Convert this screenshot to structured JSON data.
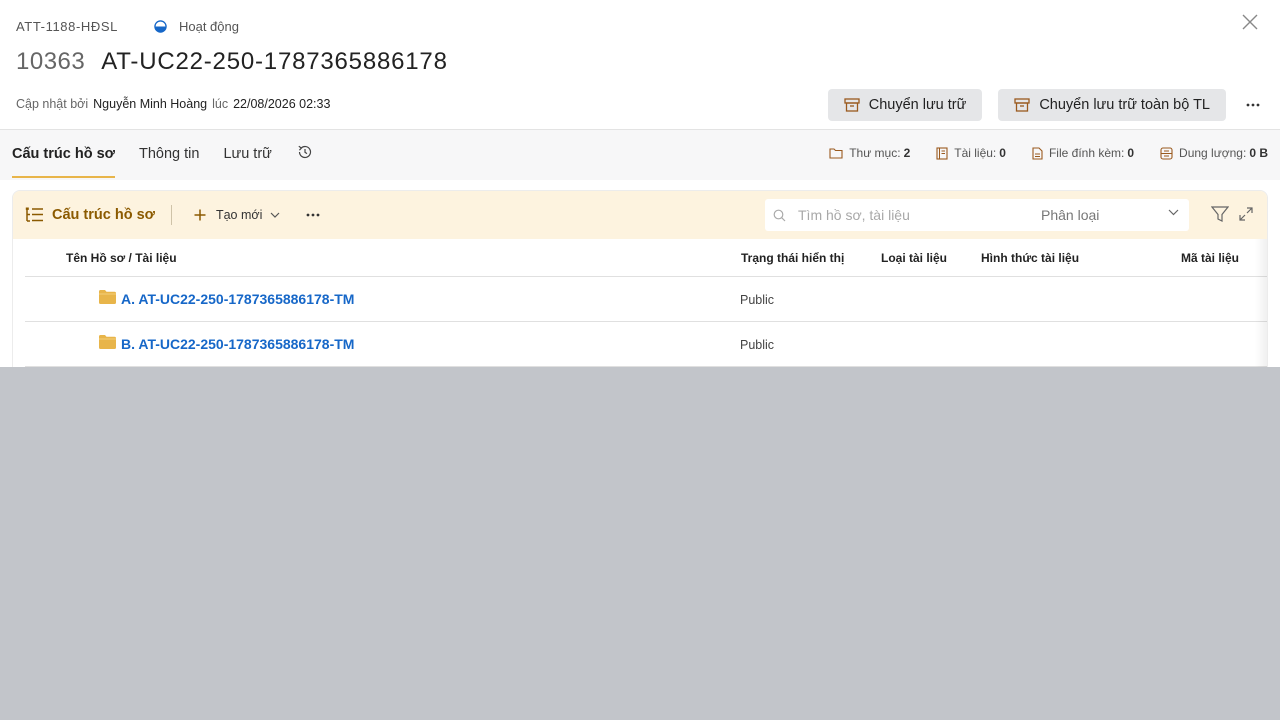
{
  "header": {
    "code": "ATT-1188-HĐSL",
    "status": "Hoạt động",
    "record_number": "10363",
    "record_title": "AT-UC22-250-1787365886178",
    "updated_by_label": "Cập nhật bởi",
    "updated_by": "Nguyễn Minh Hoàng",
    "at_label": "lúc",
    "updated_at": "22/08/2026 02:33"
  },
  "actions": {
    "archive": "Chuyển lưu trữ",
    "archive_all": "Chuyển lưu trữ toàn bộ TL"
  },
  "tabs": [
    {
      "label": "Cấu trúc hồ sơ",
      "active": true
    },
    {
      "label": "Thông tin",
      "active": false
    },
    {
      "label": "Lưu trữ",
      "active": false
    }
  ],
  "stats": {
    "folders_label": "Thư mục:",
    "folders": "2",
    "docs_label": "Tài liệu:",
    "docs": "0",
    "attachments_label": "File đính kèm:",
    "attachments": "0",
    "size_label": "Dung lượng:",
    "size": "0 B"
  },
  "toolbar": {
    "title": "Cấu trúc hồ sơ",
    "create_label": "Tạo mới",
    "search_placeholder": "Tìm hồ sơ, tài liệu",
    "classify_placeholder": "Phân loại"
  },
  "table": {
    "columns": [
      "Tên Hồ sơ / Tài liệu",
      "Trạng thái hiển thị",
      "Loại tài liệu",
      "Hình thức tài liệu",
      "Mã tài liệu"
    ],
    "rows": [
      {
        "name": "A. AT-UC22-250-1787365886178-TM",
        "visibility": "Public"
      },
      {
        "name": "B. AT-UC22-250-1787365886178-TM",
        "visibility": "Public"
      }
    ]
  },
  "colors": {
    "accent": "#e8b54a",
    "link": "#1667c8",
    "toolbar_bg": "#fdf3df",
    "toolbar_text": "#8b5a00",
    "folder": "#e8b54a",
    "backdrop": "#c2c5ca"
  }
}
